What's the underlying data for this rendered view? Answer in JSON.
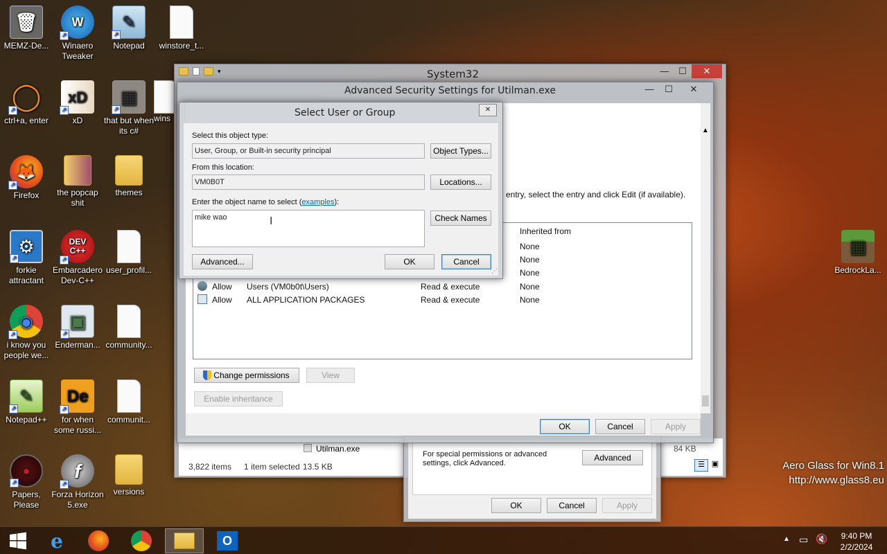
{
  "desktop": {
    "icons": [
      {
        "label": "MEMZ-De...",
        "symbol": "🗑"
      },
      {
        "label": "Winaero Tweaker",
        "symbol": "W"
      },
      {
        "label": "Notepad",
        "symbol": "✎"
      },
      {
        "label": "winstore_t...",
        "symbol": ""
      },
      {
        "label": "ctrl+a, enter",
        "symbol": "◯"
      },
      {
        "label": "xD",
        "symbol": "xD"
      },
      {
        "label": "that but when its c#",
        "symbol": "▦"
      },
      {
        "label": "wins",
        "symbol": ""
      },
      {
        "label": "Firefox",
        "symbol": "🦊"
      },
      {
        "label": "the popcap shit",
        "symbol": ""
      },
      {
        "label": "themes",
        "symbol": ""
      },
      {
        "label": "forkie attractant",
        "symbol": "⚙"
      },
      {
        "label": "Embarcadero Dev-C++",
        "symbol": "DEV C++"
      },
      {
        "label": "user_profil...",
        "symbol": ""
      },
      {
        "label": "i know you people we...",
        "symbol": "◉"
      },
      {
        "label": "Enderman...",
        "symbol": "▣"
      },
      {
        "label": "community...",
        "symbol": ""
      },
      {
        "label": "Notepad++",
        "symbol": "✎"
      },
      {
        "label": "for when some russi...",
        "symbol": "De"
      },
      {
        "label": "communit...",
        "symbol": ""
      },
      {
        "label": "Papers, Please",
        "symbol": "●"
      },
      {
        "label": "Forza Horizon 5.exe",
        "symbol": "f"
      },
      {
        "label": "versions",
        "symbol": ""
      },
      {
        "label": "BedrockLa...",
        "symbol": "▦"
      }
    ],
    "watermark": {
      "line1": "Aero Glass for Win8.1",
      "line2": "http://www.glass8.eu"
    }
  },
  "explorer": {
    "title": "System32",
    "status_items": "3,822 items",
    "status_selected": "1 item selected",
    "status_size": "13.5 KB",
    "file_name": "Utilman.exe",
    "file_size": "84 KB",
    "minimize": "—",
    "maximize": "☐",
    "close": "✕"
  },
  "security_props": {
    "help_text": "For special permissions or advanced settings, click Advanced.",
    "advanced": "Advanced",
    "ok": "OK",
    "cancel": "Cancel",
    "apply": "Apply"
  },
  "adv_security": {
    "title": "Advanced Security Settings for Utilman.exe",
    "instruction": "entry, select the entry and click Edit (if available).",
    "col_inherited": "Inherited from",
    "rows": [
      {
        "type": "",
        "principal": "",
        "access": "",
        "inherited": "None"
      },
      {
        "type": "",
        "principal": "",
        "access": "",
        "inherited": "None"
      },
      {
        "type": "",
        "principal": "",
        "access": "",
        "inherited": "None"
      },
      {
        "type": "Allow",
        "principal": "Users (VM0b0t\\Users)",
        "access": "Read & execute",
        "inherited": "None"
      },
      {
        "type": "Allow",
        "principal": "ALL APPLICATION PACKAGES",
        "access": "Read & execute",
        "inherited": "None"
      }
    ],
    "change_permissions": "Change permissions",
    "view": "View",
    "enable_inheritance": "Enable inheritance",
    "ok": "OK",
    "cancel": "Cancel",
    "apply": "Apply"
  },
  "select_user": {
    "title": "Select User or Group",
    "object_type_label": "Select this object type:",
    "object_type_value": "User, Group, or Built-in security principal",
    "object_types_button": "Object Types...",
    "location_label": "From this location:",
    "location_value": "VM0B0T",
    "locations_button": "Locations...",
    "name_label_prefix": "Enter the object name to select (",
    "name_label_link": "examples",
    "name_label_suffix": "):",
    "name_value": "mike wao",
    "check_names_button": "Check Names",
    "advanced_button": "Advanced...",
    "ok": "OK",
    "cancel": "Cancel"
  },
  "taskbar": {
    "clock_time": "9:40 PM",
    "clock_date": "2/2/2024"
  },
  "colors": {
    "accent": "#3c7fb1",
    "close_red": "#c7413a",
    "link": "#0066cc"
  }
}
